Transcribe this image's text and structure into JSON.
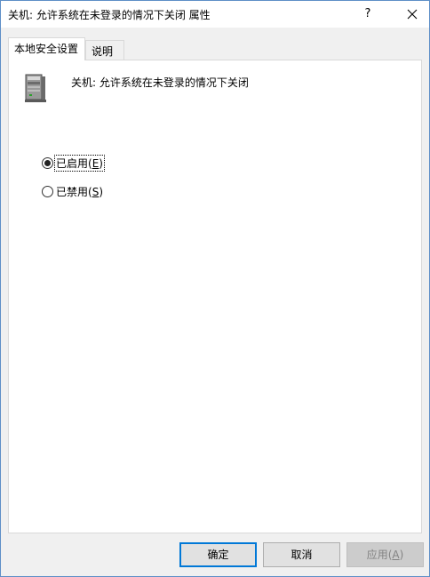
{
  "window": {
    "title": "关机: 允许系统在未登录的情况下关闭 属性",
    "help_label": "?"
  },
  "tabs": [
    {
      "label": "本地安全设置",
      "active": true
    },
    {
      "label": "说明",
      "active": false
    }
  ],
  "policy": {
    "icon": "computer-tower-icon",
    "name": "关机: 允许系统在未登录的情况下关闭"
  },
  "options": [
    {
      "label_prefix": "已启用(",
      "mnemonic": "E",
      "label_suffix": ")",
      "checked": true
    },
    {
      "label_prefix": "已禁用(",
      "mnemonic": "S",
      "label_suffix": ")",
      "checked": false
    }
  ],
  "buttons": {
    "ok": {
      "label": "确定"
    },
    "cancel": {
      "label": "取消"
    },
    "apply": {
      "label_prefix": "应用(",
      "mnemonic": "A",
      "label_suffix": ")",
      "disabled": true
    }
  },
  "colors": {
    "accent": "#0078d7",
    "window_border": "#5e8fc7"
  }
}
